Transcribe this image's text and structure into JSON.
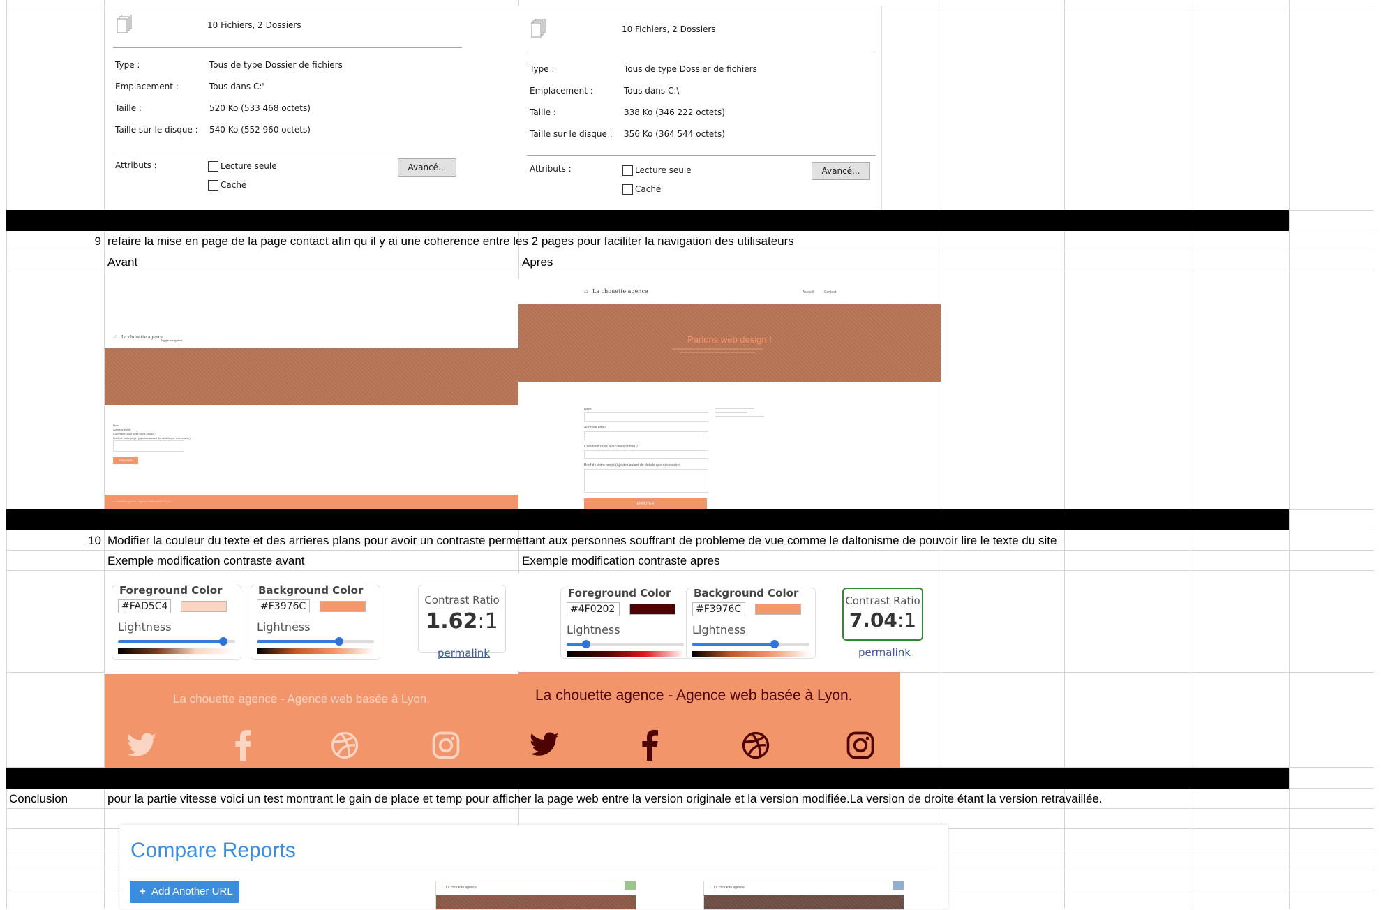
{
  "props_left": {
    "summary": "10 Fichiers, 2 Dossiers",
    "type_label": "Type :",
    "type_value": "Tous de type Dossier de fichiers",
    "location_label": "Emplacement :",
    "location_value": "Tous dans C:'",
    "size_label": "Taille :",
    "size_value": "520 Ko (533 468 octets)",
    "disk_label": "Taille sur le disque :",
    "disk_value": "540 Ko (552 960 octets)",
    "attr_label": "Attributs :",
    "readonly": "Lecture seule",
    "hidden": "Caché",
    "advanced": "Avancé..."
  },
  "props_right": {
    "summary": "10 Fichiers, 2 Dossiers",
    "type_label": "Type :",
    "type_value": "Tous de type Dossier de fichiers",
    "location_label": "Emplacement :",
    "location_value": "Tous dans C:\\",
    "size_label": "Taille :",
    "size_value": "338 Ko (346 222 octets)",
    "disk_label": "Taille sur le disque :",
    "disk_value": "356 Ko (364 544 octets)",
    "attr_label": "Attributs :",
    "readonly": "Lecture seule",
    "hidden": "Caché",
    "advanced": "Avancé..."
  },
  "row9": {
    "num": "9",
    "text": "refaire la mise en page de la page contact afin qu il y ai une coherence entre les 2 pages pour faciliter la navigation des utilisateurs",
    "before": "Avant",
    "after": "Apres"
  },
  "shot_before": {
    "logo": "La chouette agence",
    "nav": "Toggle navigation",
    "fields": [
      "Nom",
      "Adresse email",
      "Comment nous avez-vous connu ?",
      "Brief de votre projet (Ajoutez autant de détails que nécessaire)"
    ],
    "button": "ENVOYER",
    "footer": "La chouette agence - Agence web basée à Lyon"
  },
  "shot_after": {
    "logo": "La chouette agence",
    "nav_home": "Accueil",
    "nav_contact": "Contact",
    "hero_title": "Parlons web design !",
    "fields": [
      "Nom",
      "Adresse email",
      "Comment nous avez-vous connu ?",
      "Brief de votre projet (Ajoutez autant de détails que nécessaire)"
    ],
    "button": "ENVOYER"
  },
  "row10": {
    "num": "10",
    "text": "Modifier la couleur du texte et des arrieres plans pour avoir un contraste permettant aux personnes souffrant de probleme de vue comme le daltonisme de pouvoir lire le texte du site",
    "before": "Exemple modification contraste avant",
    "after": "Exemple modification contraste apres"
  },
  "contrast_before": {
    "fg_title": "Foreground Color",
    "fg_hex": "#FAD5C4",
    "fg_color": "#FAD5C4",
    "fg_lightness": 0.9,
    "bg_title": "Background Color",
    "bg_hex": "#F3976C",
    "bg_color": "#F3976C",
    "bg_lightness": 0.7,
    "lightness": "Lightness",
    "ratio_label": "Contrast Ratio",
    "ratio_bold": "1.62",
    "ratio_rest": ":1",
    "permalink": "permalink"
  },
  "contrast_after": {
    "fg_title": "Foreground Color",
    "fg_hex": "#4F0202",
    "fg_color": "#4F0202",
    "fg_lightness": 0.15,
    "bg_title": "Background Color",
    "bg_hex": "#F3976C",
    "bg_color": "#F3976C",
    "bg_lightness": 0.7,
    "lightness": "Lightness",
    "ratio_label": "Contrast Ratio",
    "ratio_bold": "7.04",
    "ratio_rest": ":1",
    "permalink": "permalink"
  },
  "footer_before": {
    "text": "La chouette agence - Agence web basée à Lyon.",
    "color": "#FAD5C4"
  },
  "footer_after": {
    "text": "La chouette agence - Agence web basée à Lyon.",
    "color": "#4F0202"
  },
  "conclusion": {
    "label": "Conclusion",
    "text": "pour la partie vitesse voici un test montrant le gain de place et temp pour afficher la page web entre la version originale et la version modifiée.La version de droite étant la version retravaillée."
  },
  "compare": {
    "title": "Compare Reports",
    "add_url": "Add Another URL",
    "shot_logo": "La chouette agence"
  }
}
